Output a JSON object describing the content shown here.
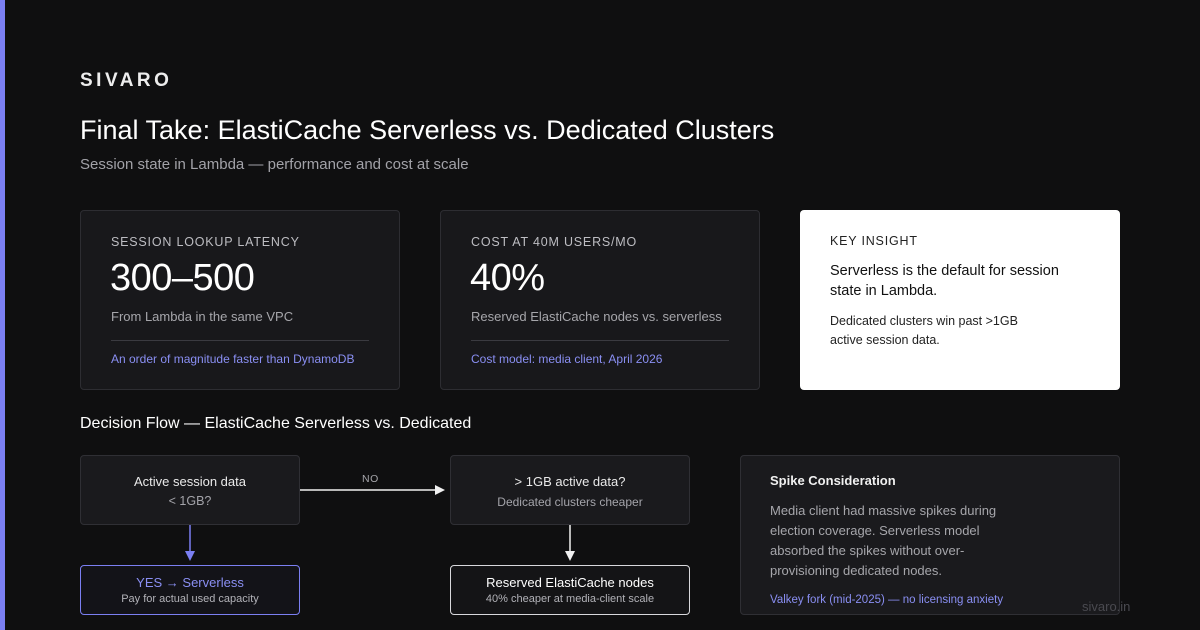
{
  "brand": "SIVARO",
  "title": "Final Take: ElastiCache Serverless vs. Dedicated Clusters",
  "subtitle": "Session state in Lambda — performance and cost at scale",
  "cards": [
    {
      "kicker": "SESSION LOOKUP LATENCY",
      "value": "300–500",
      "desc": "From Lambda in the same VPC",
      "note": "An order of magnitude faster than DynamoDB"
    },
    {
      "kicker": "COST AT 40M USERS/MO",
      "value": "40%",
      "desc": "Reserved ElastiCache nodes vs. serverless",
      "note": "Cost model: media client, April 2026"
    }
  ],
  "insight": {
    "kicker": "KEY INSIGHT",
    "headline": "Serverless is the default for session state in Lambda.",
    "body": "Dedicated clusters win past >1GB active session data."
  },
  "flow": {
    "section_title": "Decision Flow — ElastiCache Serverless vs. Dedicated",
    "start": {
      "line1": "Active session data",
      "line2": "< 1GB?"
    },
    "no_label": "NO",
    "over": {
      "line1": "> 1GB active data?",
      "line2": "Dedicated clusters cheaper"
    },
    "yes": {
      "line1": "YES → Serverless",
      "line2": "Pay for actual used capacity"
    },
    "reserved": {
      "line1": "Reserved ElastiCache nodes",
      "line2": "40% cheaper at media-client scale"
    }
  },
  "spike": {
    "heading": "Spike Consideration",
    "body": "Media client had massive spikes during election coverage. Serverless model absorbed the spikes without over-provisioning dedicated nodes.",
    "footer": "Valkey fork (mid-2025) — no licensing anxiety"
  },
  "watermark": "sivaro.in",
  "colors": {
    "accent": "#7b7ff2",
    "background": "#0f0f10"
  }
}
